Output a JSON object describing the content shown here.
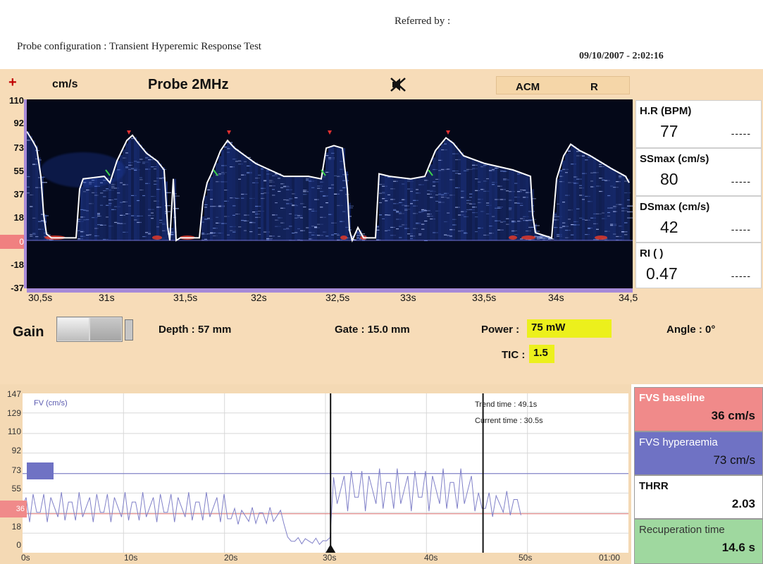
{
  "header": {
    "referred_by": "Referred by :",
    "probe_configuration": "Probe configuration : Transient Hyperemic Response Test",
    "datetime": "09/10/2007  -   2:02:16"
  },
  "doppler": {
    "unit": "cm/s",
    "probe": "Probe 2MHz",
    "mode": "ACM",
    "side": "R",
    "zero_badge": "0",
    "y_ticks": [
      "110",
      "92",
      "73",
      "55",
      "37",
      "18",
      "-18",
      "-37"
    ],
    "x_ticks": [
      "30,5s",
      "31s",
      "31,5s",
      "32s",
      "32,5s",
      "33s",
      "33,5s",
      "34s",
      "34,5"
    ],
    "icons": {
      "plus": "plus-icon",
      "mute": "speaker-mute-icon"
    },
    "colors": {
      "spectrum_bg": "#040818",
      "envelope": "#ffffff",
      "axis": "#a78ad8"
    }
  },
  "metrics": [
    {
      "name": "H.R (BPM)",
      "value": "77",
      "extra": "-----"
    },
    {
      "name": "SSmax (cm/s)",
      "value": "80",
      "extra": "-----"
    },
    {
      "name": "DSmax (cm/s)",
      "value": "42",
      "extra": "-----"
    },
    {
      "name": "RI ( )",
      "value": "0.47",
      "extra": "-----"
    }
  ],
  "controls": {
    "gain_label": "Gain",
    "depth": "Depth : 57 mm",
    "gate": "Gate : 15.0 mm",
    "power_label": "Power :",
    "power_value": "75 mW",
    "tic_label": "TIC :",
    "tic_value": "1.5",
    "angle": "Angle : 0°"
  },
  "trend": {
    "series_label": "FV (cm/s)",
    "trend_time": "Trend time :   49.1s",
    "current_time": "Current time :   30.5s",
    "baseline_badge": "36",
    "y_ticks": [
      "147",
      "129",
      "110",
      "92",
      "73",
      "55",
      "37",
      "18",
      "0"
    ],
    "x_ticks": [
      "0s",
      "10s",
      "20s",
      "30s",
      "40s",
      "50s",
      "01:00"
    ],
    "baseline_value": 36,
    "hyperaemia_value": 73
  },
  "results": [
    {
      "name": "FVS baseline",
      "value": "36 cm/s",
      "color": "#f08a8a"
    },
    {
      "name": "FVS hyperaemia",
      "value": "73 cm/s",
      "color": "#6f72c4"
    },
    {
      "name": "THRR",
      "value": "2.03",
      "color": "#ffffff"
    },
    {
      "name": "Recuperation time",
      "value": "14.6 s",
      "color": "#9fd89f"
    }
  ]
}
